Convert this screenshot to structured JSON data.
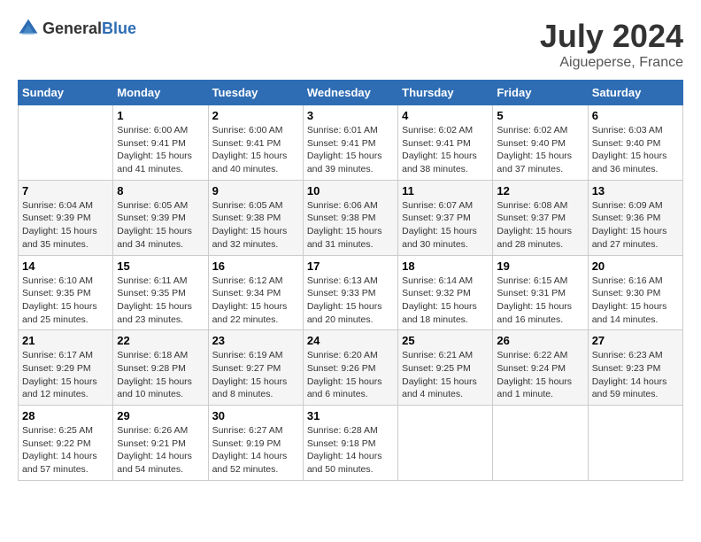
{
  "logo": {
    "general": "General",
    "blue": "Blue"
  },
  "header": {
    "month": "July 2024",
    "location": "Aigueperse, France"
  },
  "weekdays": [
    "Sunday",
    "Monday",
    "Tuesday",
    "Wednesday",
    "Thursday",
    "Friday",
    "Saturday"
  ],
  "weeks": [
    [
      {
        "day": "",
        "info": ""
      },
      {
        "day": "1",
        "info": "Sunrise: 6:00 AM\nSunset: 9:41 PM\nDaylight: 15 hours\nand 41 minutes."
      },
      {
        "day": "2",
        "info": "Sunrise: 6:00 AM\nSunset: 9:41 PM\nDaylight: 15 hours\nand 40 minutes."
      },
      {
        "day": "3",
        "info": "Sunrise: 6:01 AM\nSunset: 9:41 PM\nDaylight: 15 hours\nand 39 minutes."
      },
      {
        "day": "4",
        "info": "Sunrise: 6:02 AM\nSunset: 9:41 PM\nDaylight: 15 hours\nand 38 minutes."
      },
      {
        "day": "5",
        "info": "Sunrise: 6:02 AM\nSunset: 9:40 PM\nDaylight: 15 hours\nand 37 minutes."
      },
      {
        "day": "6",
        "info": "Sunrise: 6:03 AM\nSunset: 9:40 PM\nDaylight: 15 hours\nand 36 minutes."
      }
    ],
    [
      {
        "day": "7",
        "info": "Sunrise: 6:04 AM\nSunset: 9:39 PM\nDaylight: 15 hours\nand 35 minutes."
      },
      {
        "day": "8",
        "info": "Sunrise: 6:05 AM\nSunset: 9:39 PM\nDaylight: 15 hours\nand 34 minutes."
      },
      {
        "day": "9",
        "info": "Sunrise: 6:05 AM\nSunset: 9:38 PM\nDaylight: 15 hours\nand 32 minutes."
      },
      {
        "day": "10",
        "info": "Sunrise: 6:06 AM\nSunset: 9:38 PM\nDaylight: 15 hours\nand 31 minutes."
      },
      {
        "day": "11",
        "info": "Sunrise: 6:07 AM\nSunset: 9:37 PM\nDaylight: 15 hours\nand 30 minutes."
      },
      {
        "day": "12",
        "info": "Sunrise: 6:08 AM\nSunset: 9:37 PM\nDaylight: 15 hours\nand 28 minutes."
      },
      {
        "day": "13",
        "info": "Sunrise: 6:09 AM\nSunset: 9:36 PM\nDaylight: 15 hours\nand 27 minutes."
      }
    ],
    [
      {
        "day": "14",
        "info": "Sunrise: 6:10 AM\nSunset: 9:35 PM\nDaylight: 15 hours\nand 25 minutes."
      },
      {
        "day": "15",
        "info": "Sunrise: 6:11 AM\nSunset: 9:35 PM\nDaylight: 15 hours\nand 23 minutes."
      },
      {
        "day": "16",
        "info": "Sunrise: 6:12 AM\nSunset: 9:34 PM\nDaylight: 15 hours\nand 22 minutes."
      },
      {
        "day": "17",
        "info": "Sunrise: 6:13 AM\nSunset: 9:33 PM\nDaylight: 15 hours\nand 20 minutes."
      },
      {
        "day": "18",
        "info": "Sunrise: 6:14 AM\nSunset: 9:32 PM\nDaylight: 15 hours\nand 18 minutes."
      },
      {
        "day": "19",
        "info": "Sunrise: 6:15 AM\nSunset: 9:31 PM\nDaylight: 15 hours\nand 16 minutes."
      },
      {
        "day": "20",
        "info": "Sunrise: 6:16 AM\nSunset: 9:30 PM\nDaylight: 15 hours\nand 14 minutes."
      }
    ],
    [
      {
        "day": "21",
        "info": "Sunrise: 6:17 AM\nSunset: 9:29 PM\nDaylight: 15 hours\nand 12 minutes."
      },
      {
        "day": "22",
        "info": "Sunrise: 6:18 AM\nSunset: 9:28 PM\nDaylight: 15 hours\nand 10 minutes."
      },
      {
        "day": "23",
        "info": "Sunrise: 6:19 AM\nSunset: 9:27 PM\nDaylight: 15 hours\nand 8 minutes."
      },
      {
        "day": "24",
        "info": "Sunrise: 6:20 AM\nSunset: 9:26 PM\nDaylight: 15 hours\nand 6 minutes."
      },
      {
        "day": "25",
        "info": "Sunrise: 6:21 AM\nSunset: 9:25 PM\nDaylight: 15 hours\nand 4 minutes."
      },
      {
        "day": "26",
        "info": "Sunrise: 6:22 AM\nSunset: 9:24 PM\nDaylight: 15 hours\nand 1 minute."
      },
      {
        "day": "27",
        "info": "Sunrise: 6:23 AM\nSunset: 9:23 PM\nDaylight: 14 hours\nand 59 minutes."
      }
    ],
    [
      {
        "day": "28",
        "info": "Sunrise: 6:25 AM\nSunset: 9:22 PM\nDaylight: 14 hours\nand 57 minutes."
      },
      {
        "day": "29",
        "info": "Sunrise: 6:26 AM\nSunset: 9:21 PM\nDaylight: 14 hours\nand 54 minutes."
      },
      {
        "day": "30",
        "info": "Sunrise: 6:27 AM\nSunset: 9:19 PM\nDaylight: 14 hours\nand 52 minutes."
      },
      {
        "day": "31",
        "info": "Sunrise: 6:28 AM\nSunset: 9:18 PM\nDaylight: 14 hours\nand 50 minutes."
      },
      {
        "day": "",
        "info": ""
      },
      {
        "day": "",
        "info": ""
      },
      {
        "day": "",
        "info": ""
      }
    ]
  ]
}
